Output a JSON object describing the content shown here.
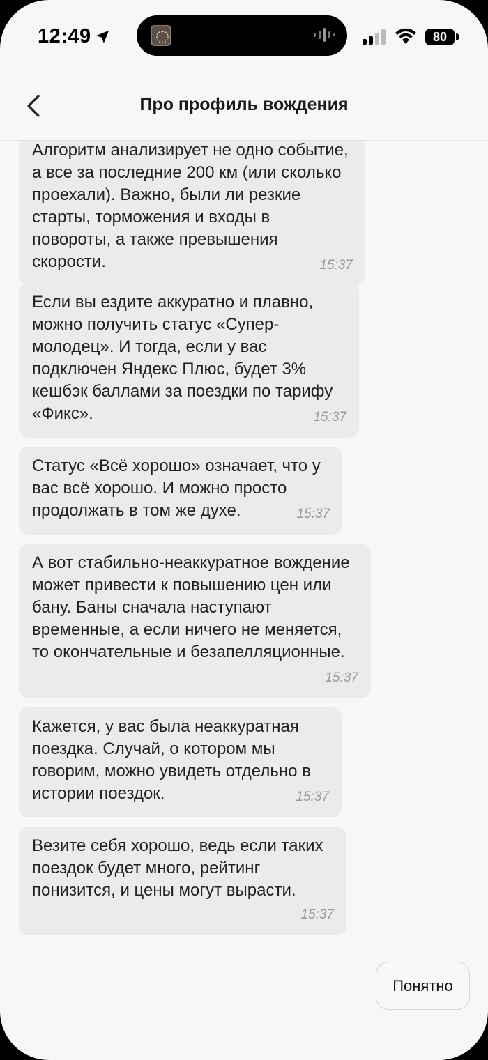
{
  "status_bar": {
    "time": "12:49",
    "battery": "80",
    "icons": [
      "location-arrow-icon",
      "signal-icon",
      "wifi-icon",
      "battery-icon"
    ]
  },
  "header": {
    "title": "Про профиль вождения",
    "back_icon": "chevron-left-icon"
  },
  "messages": [
    {
      "text": "Алгоритм анализирует не одно событие, а все за последние 200 км (или сколько проехали). Важно, были ли резкие старты, торможения и входы в повороты, а также превышения скорости.",
      "time": "15:37"
    },
    {
      "text": "Если вы ездите аккуратно и плавно, можно получить статус «Супер-молодец». И тогда, если у вас подключен Яндекс Плюс, будет 3% кешбэк баллами за поездки по тарифу «Фикс».",
      "time": "15:37"
    },
    {
      "text": "Статус «Всё хорошо» означает, что у вас всё хорошо. И можно просто продолжать в том же духе.",
      "time": "15:37"
    },
    {
      "text": "А вот стабильно-неаккуратное вождение может привести к повышению цен или бану. Баны сначала наступают временные, а если ничего не меняется, то окончательные и безапелляционные.",
      "time": "15:37"
    },
    {
      "text": "Кажется, у вас была неаккуратная поездка. Случай, о котором мы говорим, можно увидеть отдельно в истории поездок.",
      "time": "15:37"
    },
    {
      "text": "Везите себя хорошо, ведь если таких поездок будет много, рейтинг понизится, и цены могут вырасти.",
      "time": "15:37"
    }
  ],
  "actions": {
    "ok_label": "Понятно"
  }
}
